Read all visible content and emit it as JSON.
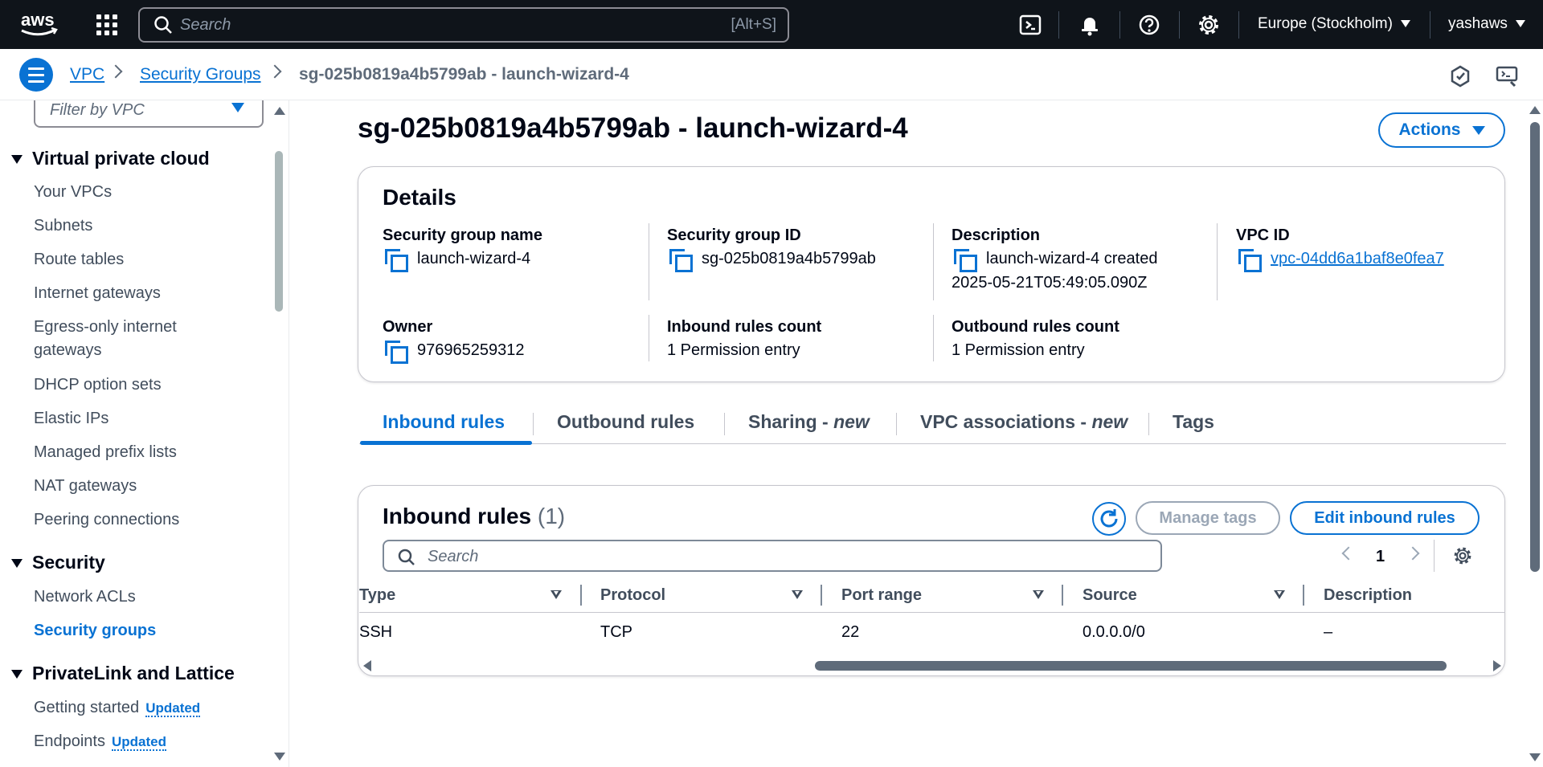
{
  "topnav": {
    "logo_text": "aws",
    "search_placeholder": "Search",
    "search_shortcut": "[Alt+S]",
    "region": "Europe (Stockholm)",
    "user": "yashaws"
  },
  "breadcrumb": {
    "items": [
      "VPC",
      "Security Groups",
      "sg-025b0819a4b5799ab - launch-wizard-4"
    ]
  },
  "sidebar": {
    "filter_placeholder": "Filter by VPC",
    "sections": [
      {
        "title": "Virtual private cloud",
        "items": [
          "Your VPCs",
          "Subnets",
          "Route tables",
          "Internet gateways",
          "Egress-only internet gateways",
          "DHCP option sets",
          "Elastic IPs",
          "Managed prefix lists",
          "NAT gateways",
          "Peering connections"
        ]
      },
      {
        "title": "Security",
        "items": [
          "Network ACLs",
          "Security groups"
        ]
      },
      {
        "title": "PrivateLink and Lattice",
        "items": [
          "Getting started",
          "Endpoints"
        ]
      }
    ],
    "badge": "Updated",
    "active_item": "Security groups"
  },
  "page": {
    "title": "sg-025b0819a4b5799ab - launch-wizard-4",
    "actions_label": "Actions"
  },
  "details": {
    "title": "Details",
    "sg_name_label": "Security group name",
    "sg_name": "launch-wizard-4",
    "sg_id_label": "Security group ID",
    "sg_id": "sg-025b0819a4b5799ab",
    "description_label": "Description",
    "description_line1": "launch-wizard-4 created",
    "description_line2": "2025-05-21T05:49:05.090Z",
    "vpc_id_label": "VPC ID",
    "vpc_id": "vpc-04dd6a1baf8e0fea7",
    "owner_label": "Owner",
    "owner": "976965259312",
    "inbound_count_label": "Inbound rules count",
    "inbound_count": "1 Permission entry",
    "outbound_count_label": "Outbound rules count",
    "outbound_count": "1 Permission entry"
  },
  "tabs": {
    "inbound": "Inbound rules",
    "outbound": "Outbound rules",
    "sharing": "Sharing - ",
    "vpc_assoc": "VPC associations - ",
    "new": "new",
    "tags": "Tags"
  },
  "inbound_rules": {
    "title": "Inbound rules",
    "count": "(1)",
    "manage_tags": "Manage tags",
    "edit": "Edit inbound rules",
    "search_placeholder": "Search",
    "page": "1",
    "columns": [
      "Type",
      "Protocol",
      "Port range",
      "Source",
      "Description"
    ],
    "rows": [
      [
        "SSH",
        "TCP",
        "22",
        "0.0.0.0/0",
        "–"
      ]
    ]
  }
}
